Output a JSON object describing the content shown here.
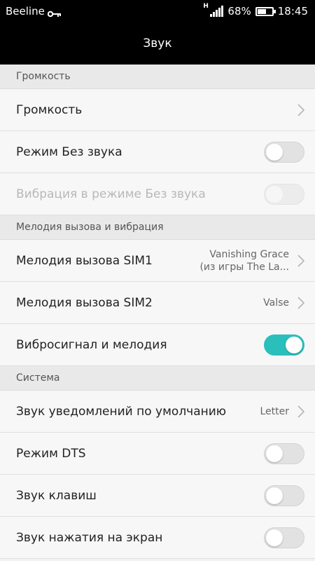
{
  "status_bar": {
    "carrier": "Beeline",
    "network_type": "H",
    "battery_percent": "68%",
    "battery_level": 0.68,
    "time": "18:45",
    "icons": [
      "key-icon",
      "signal-icon",
      "battery-icon"
    ]
  },
  "header": {
    "title": "Звук"
  },
  "sections": {
    "volume": {
      "header": "Громкость",
      "volume_label": "Громкость",
      "silent_mode_label": "Режим Без звука",
      "silent_mode_on": false,
      "vibration_silent_label": "Вибрация в режиме Без звука",
      "vibration_silent_enabled": false
    },
    "ringtone": {
      "header": "Мелодия вызова и вибрация",
      "sim1_label": "Мелодия вызова SIM1",
      "sim1_value_line1": "Vanishing Grace",
      "sim1_value_line2": "(из игры The La...",
      "sim2_label": "Мелодия вызова SIM2",
      "sim2_value": "Valse",
      "vibro_ring_label": "Вибросигнал и мелодия",
      "vibro_ring_on": true
    },
    "system": {
      "header": "Система",
      "notification_sound_label": "Звук уведомлений по умолчанию",
      "notification_sound_value": "Letter",
      "dts_label": "Режим DTS",
      "dts_on": false,
      "key_sound_label": "Звук клавиш",
      "key_sound_on": false,
      "touch_sound_label": "Звук нажатия на экран",
      "touch_sound_on": false
    }
  },
  "colors": {
    "accent": "#2bbfbc",
    "bar_background": "#000000"
  }
}
